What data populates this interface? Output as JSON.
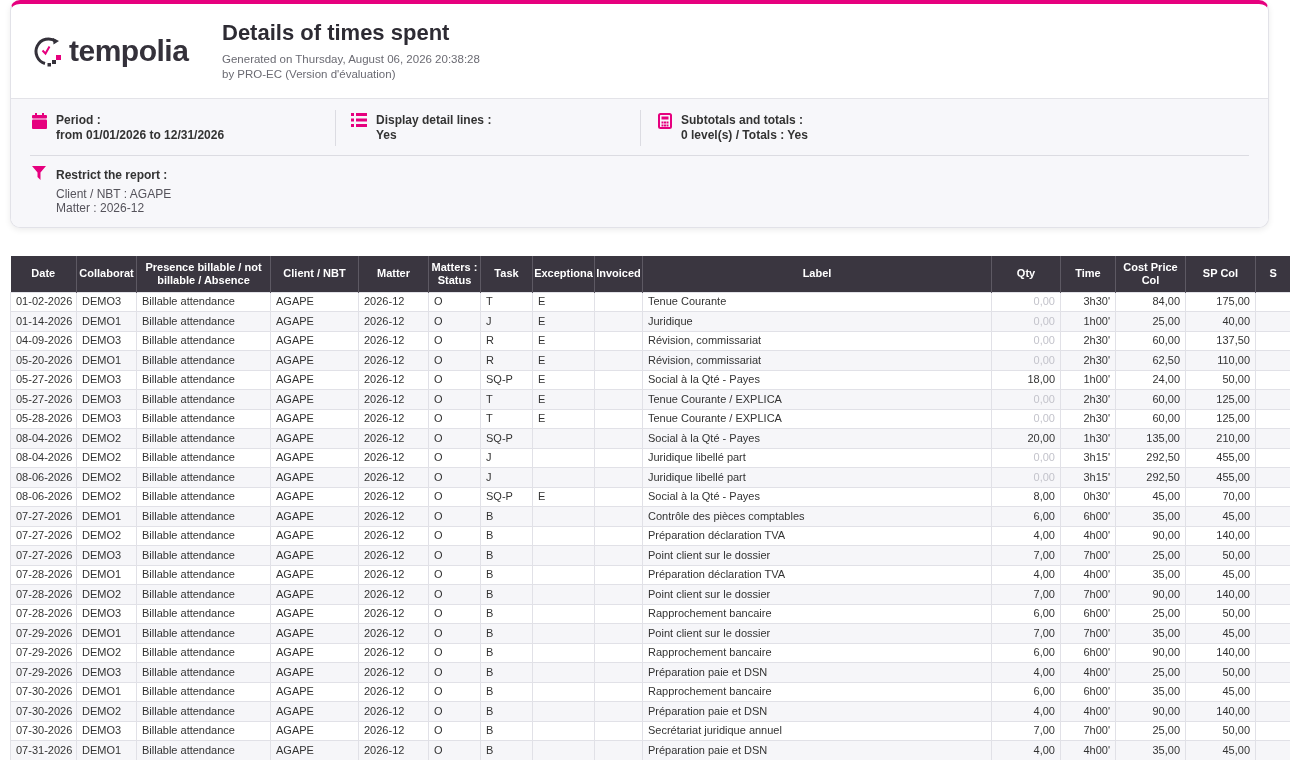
{
  "header": {
    "logo": "tempolia",
    "title": "Details of times spent",
    "generated": "Generated on Thursday, August 06, 2026 20:38:28",
    "by": "by PRO-EC (Version d'évaluation)"
  },
  "settings": [
    {
      "kind": "calendar",
      "label": "Period :",
      "value": "from 01/01/2026 to 12/31/2026"
    },
    {
      "kind": "list",
      "label": "Display detail lines :",
      "value": "Yes"
    },
    {
      "kind": "calculator",
      "label": "Subtotals and totals :",
      "value": "0 level(s) / Totals : Yes"
    }
  ],
  "restriction": {
    "label": "Restrict the report :",
    "lines": [
      "Client / NBT : AGAPE",
      "Matter : 2026-12"
    ]
  },
  "table": {
    "columns": [
      "Date",
      "Collaborat",
      "Presence billable / not billable / Absence",
      "Client / NBT",
      "Matter",
      "Matters : Status",
      "Task",
      "Exceptiona",
      "Invoiced",
      "Label",
      "Qty",
      "Time",
      "Cost Price Col",
      "SP Col",
      "S"
    ],
    "rows": [
      {
        "date": "01-02-2026",
        "column_2": "DEMO3",
        "presence": "Billable attendance",
        "client": "AGAPE",
        "matter": "2026-12",
        "matter_status": "O",
        "task": "T",
        "column_8": "E",
        "label": "Tenue Courante",
        "qty": "0,00",
        "qty_muted": true,
        "time": "3h30'",
        "cost_price": "84,00",
        "sp_col": "175,00"
      },
      {
        "date": "01-14-2026",
        "column_2": "DEMO1",
        "presence": "Billable attendance",
        "client": "AGAPE",
        "matter": "2026-12",
        "matter_status": "O",
        "task": "J",
        "column_8": "E",
        "label": "Juridique",
        "qty": "0,00",
        "qty_muted": true,
        "time": "1h00'",
        "cost_price": "25,00",
        "sp_col": "40,00"
      },
      {
        "date": "04-09-2026",
        "column_2": "DEMO3",
        "presence": "Billable attendance",
        "client": "AGAPE",
        "matter": "2026-12",
        "matter_status": "O",
        "task": "R",
        "column_8": "E",
        "label": "Révision, commissariat",
        "qty": "0,00",
        "qty_muted": true,
        "time": "2h30'",
        "cost_price": "60,00",
        "sp_col": "137,50"
      },
      {
        "date": "05-20-2026",
        "column_2": "DEMO1",
        "presence": "Billable attendance",
        "client": "AGAPE",
        "matter": "2026-12",
        "matter_status": "O",
        "task": "R",
        "column_8": "E",
        "label": "Révision, commissariat",
        "qty": "0,00",
        "qty_muted": true,
        "time": "2h30'",
        "cost_price": "62,50",
        "sp_col": "110,00"
      },
      {
        "date": "05-27-2026",
        "column_2": "DEMO3",
        "presence": "Billable attendance",
        "client": "AGAPE",
        "matter": "2026-12",
        "matter_status": "O",
        "task": "SQ-P",
        "column_8": "E",
        "label": "Social à la Qté - Payes",
        "qty": "18,00",
        "qty_muted": false,
        "time": "1h00'",
        "cost_price": "24,00",
        "sp_col": "50,00"
      },
      {
        "date": "05-27-2026",
        "column_2": "DEMO3",
        "presence": "Billable attendance",
        "client": "AGAPE",
        "matter": "2026-12",
        "matter_status": "O",
        "task": "T",
        "column_8": "E",
        "label": "Tenue Courante / EXPLICA",
        "qty": "0,00",
        "qty_muted": true,
        "time": "2h30'",
        "cost_price": "60,00",
        "sp_col": "125,00"
      },
      {
        "date": "05-28-2026",
        "column_2": "DEMO3",
        "presence": "Billable attendance",
        "client": "AGAPE",
        "matter": "2026-12",
        "matter_status": "O",
        "task": "T",
        "column_8": "E",
        "label": "Tenue Courante / EXPLICA",
        "qty": "0,00",
        "qty_muted": true,
        "time": "2h30'",
        "cost_price": "60,00",
        "sp_col": "125,00"
      },
      {
        "date": "08-04-2026",
        "column_2": "DEMO2",
        "presence": "Billable attendance",
        "client": "AGAPE",
        "matter": "2026-12",
        "matter_status": "O",
        "task": "SQ-P",
        "label": "Social à la Qté - Payes",
        "qty": "20,00",
        "qty_muted": false,
        "time": "1h30'",
        "cost_price": "135,00",
        "sp_col": "210,00"
      },
      {
        "date": "08-04-2026",
        "column_2": "DEMO2",
        "presence": "Billable attendance",
        "client": "AGAPE",
        "matter": "2026-12",
        "matter_status": "O",
        "task": "J",
        "label": "Juridique libellé part",
        "qty": "0,00",
        "qty_muted": true,
        "time": "3h15'",
        "cost_price": "292,50",
        "sp_col": "455,00"
      },
      {
        "date": "08-06-2026",
        "column_2": "DEMO2",
        "presence": "Billable attendance",
        "client": "AGAPE",
        "matter": "2026-12",
        "matter_status": "O",
        "task": "J",
        "label": "Juridique libellé part",
        "qty": "0,00",
        "qty_muted": true,
        "time": "3h15'",
        "cost_price": "292,50",
        "sp_col": "455,00"
      },
      {
        "date": "08-06-2026",
        "column_2": "DEMO2",
        "presence": "Billable attendance",
        "client": "AGAPE",
        "matter": "2026-12",
        "matter_status": "O",
        "task": "SQ-P",
        "column_8": "E",
        "label": "Social à la Qté - Payes",
        "qty": "8,00",
        "qty_muted": false,
        "time": "0h30'",
        "cost_price": "45,00",
        "sp_col": "70,00"
      },
      {
        "date": "07-27-2026",
        "column_2": "DEMO1",
        "presence": "Billable attendance",
        "client": "AGAPE",
        "matter": "2026-12",
        "matter_status": "O",
        "task": "B",
        "label": "Contrôle des pièces comptables",
        "qty": "6,00",
        "qty_muted": false,
        "time": "6h00'",
        "cost_price": "35,00",
        "sp_col": "45,00"
      },
      {
        "date": "07-27-2026",
        "column_2": "DEMO2",
        "presence": "Billable attendance",
        "client": "AGAPE",
        "matter": "2026-12",
        "matter_status": "O",
        "task": "B",
        "label": "Préparation déclaration TVA",
        "qty": "4,00",
        "qty_muted": false,
        "time": "4h00'",
        "cost_price": "90,00",
        "sp_col": "140,00"
      },
      {
        "date": "07-27-2026",
        "column_2": "DEMO3",
        "presence": "Billable attendance",
        "client": "AGAPE",
        "matter": "2026-12",
        "matter_status": "O",
        "task": "B",
        "label": "Point client sur le dossier",
        "qty": "7,00",
        "qty_muted": false,
        "time": "7h00'",
        "cost_price": "25,00",
        "sp_col": "50,00"
      },
      {
        "date": "07-28-2026",
        "column_2": "DEMO1",
        "presence": "Billable attendance",
        "client": "AGAPE",
        "matter": "2026-12",
        "matter_status": "O",
        "task": "B",
        "label": "Préparation déclaration TVA",
        "qty": "4,00",
        "qty_muted": false,
        "time": "4h00'",
        "cost_price": "35,00",
        "sp_col": "45,00"
      },
      {
        "date": "07-28-2026",
        "column_2": "DEMO2",
        "presence": "Billable attendance",
        "client": "AGAPE",
        "matter": "2026-12",
        "matter_status": "O",
        "task": "B",
        "label": "Point client sur le dossier",
        "qty": "7,00",
        "qty_muted": false,
        "time": "7h00'",
        "cost_price": "90,00",
        "sp_col": "140,00"
      },
      {
        "date": "07-28-2026",
        "column_2": "DEMO3",
        "presence": "Billable attendance",
        "client": "AGAPE",
        "matter": "2026-12",
        "matter_status": "O",
        "task": "B",
        "label": "Rapprochement bancaire",
        "qty": "6,00",
        "qty_muted": false,
        "time": "6h00'",
        "cost_price": "25,00",
        "sp_col": "50,00"
      },
      {
        "date": "07-29-2026",
        "column_2": "DEMO1",
        "presence": "Billable attendance",
        "client": "AGAPE",
        "matter": "2026-12",
        "matter_status": "O",
        "task": "B",
        "label": "Point client sur le dossier",
        "qty": "7,00",
        "qty_muted": false,
        "time": "7h00'",
        "cost_price": "35,00",
        "sp_col": "45,00"
      },
      {
        "date": "07-29-2026",
        "column_2": "DEMO2",
        "presence": "Billable attendance",
        "client": "AGAPE",
        "matter": "2026-12",
        "matter_status": "O",
        "task": "B",
        "label": "Rapprochement bancaire",
        "qty": "6,00",
        "qty_muted": false,
        "time": "6h00'",
        "cost_price": "90,00",
        "sp_col": "140,00"
      },
      {
        "date": "07-29-2026",
        "column_2": "DEMO3",
        "presence": "Billable attendance",
        "client": "AGAPE",
        "matter": "2026-12",
        "matter_status": "O",
        "task": "B",
        "label": "Préparation paie et DSN",
        "qty": "4,00",
        "qty_muted": false,
        "time": "4h00'",
        "cost_price": "25,00",
        "sp_col": "50,00"
      },
      {
        "date": "07-30-2026",
        "column_2": "DEMO1",
        "presence": "Billable attendance",
        "client": "AGAPE",
        "matter": "2026-12",
        "matter_status": "O",
        "task": "B",
        "label": "Rapprochement bancaire",
        "qty": "6,00",
        "qty_muted": false,
        "time": "6h00'",
        "cost_price": "35,00",
        "sp_col": "45,00"
      },
      {
        "date": "07-30-2026",
        "column_2": "DEMO2",
        "presence": "Billable attendance",
        "client": "AGAPE",
        "matter": "2026-12",
        "matter_status": "O",
        "task": "B",
        "label": "Préparation paie et DSN",
        "qty": "4,00",
        "qty_muted": false,
        "time": "4h00'",
        "cost_price": "90,00",
        "sp_col": "140,00"
      },
      {
        "date": "07-30-2026",
        "column_2": "DEMO3",
        "presence": "Billable attendance",
        "client": "AGAPE",
        "matter": "2026-12",
        "matter_status": "O",
        "task": "B",
        "label": "Secrétariat juridique annuel",
        "qty": "7,00",
        "qty_muted": false,
        "time": "7h00'",
        "cost_price": "25,00",
        "sp_col": "50,00"
      },
      {
        "date": "07-31-2026",
        "column_2": "DEMO1",
        "presence": "Billable attendance",
        "client": "AGAPE",
        "matter": "2026-12",
        "matter_status": "O",
        "task": "B",
        "label": "Préparation paie et DSN",
        "qty": "4,00",
        "qty_muted": false,
        "time": "4h00'",
        "cost_price": "35,00",
        "sp_col": "45,00"
      }
    ]
  }
}
